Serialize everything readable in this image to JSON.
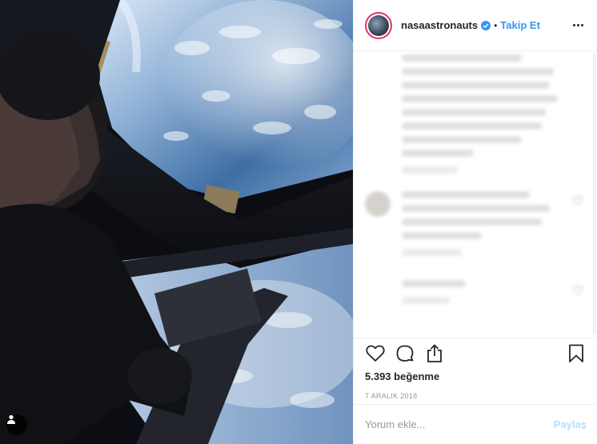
{
  "post": {
    "username": "nasaastronauts",
    "separator": "•",
    "follow_label": "Takip Et",
    "likes_text": "5.393 beğenme",
    "date": "7 ARALIK 2018",
    "comment_placeholder": "Yorum ekle...",
    "post_label": "Paylaş"
  },
  "icons": {
    "verified": "verified-badge-icon",
    "more": "more-options-icon",
    "like": "heart-icon",
    "comment": "comment-bubble-icon",
    "share": "share-icon",
    "save": "bookmark-icon",
    "user_tag": "user-tag-icon"
  },
  "colors": {
    "link_blue": "#3897f0",
    "disabled_post": "#b2dffc",
    "verified_blue": "#3897f0"
  }
}
